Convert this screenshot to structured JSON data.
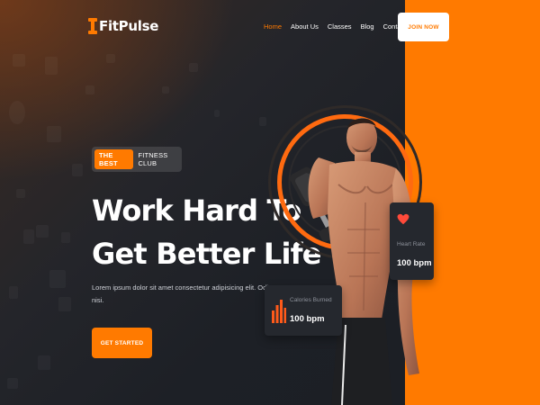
{
  "brand": {
    "name": "FitPulse",
    "accent": "#ff7a00",
    "icon": "dumbbell-icon"
  },
  "nav": {
    "items": [
      {
        "label": "Home",
        "active": true
      },
      {
        "label": "About Us",
        "active": false
      },
      {
        "label": "Classes",
        "active": false
      },
      {
        "label": "Blog",
        "active": false
      },
      {
        "label": "Contact Us",
        "active": false
      }
    ],
    "cta_label": "JOIN NOW"
  },
  "hero": {
    "badge_highlight": "THE BEST",
    "badge_text": "FITNESS CLUB",
    "headline_line1": "Work Hard To",
    "headline_line2": "Get Better Life",
    "description": "Lorem ipsum dolor sit amet consectetur adipisicing elit. Odit, nisi.",
    "cta_label": "GET STARTED"
  },
  "stats": {
    "heart_rate": {
      "label": "Heart Rate",
      "value": "100 bpm",
      "icon": "heart-icon"
    },
    "calories": {
      "label": "Calories Burned",
      "value": "100 bpm",
      "icon": "bar-chart-icon"
    }
  }
}
